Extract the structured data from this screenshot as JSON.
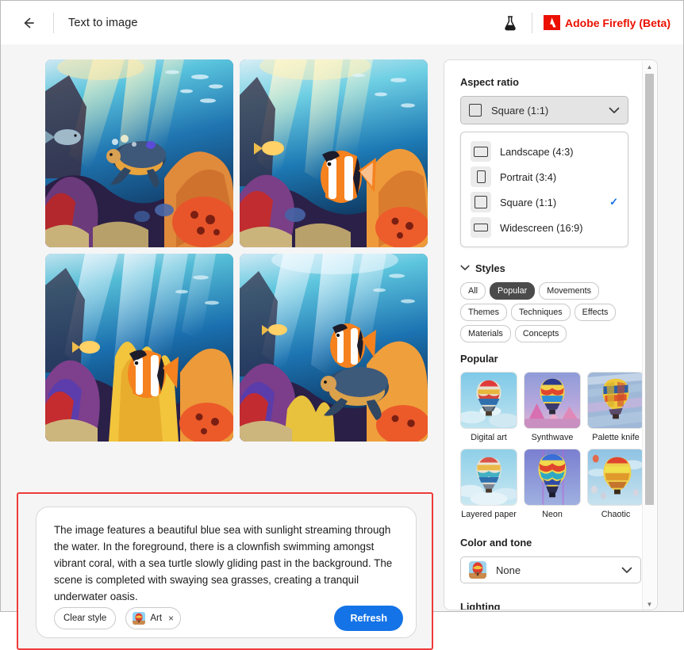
{
  "topbar": {
    "back_icon": "arrow-left-icon",
    "title": "Text to image",
    "beaker_icon": "flask-icon",
    "brand": "Adobe Firefly (Beta)",
    "brand_color": "#eb1000"
  },
  "gallery": {
    "count": 4,
    "items": [
      {
        "alt": "underwater scene with sea turtle and coral"
      },
      {
        "alt": "underwater scene with clownfish and coral"
      },
      {
        "alt": "underwater scene with clownfish and yellow coral"
      },
      {
        "alt": "underwater scene with clownfish and sea turtle"
      }
    ]
  },
  "prompt": {
    "text": "The image features a beautiful blue sea with sunlight streaming through the water. In the foreground, there is a clownfish swimming amongst vibrant coral, with a sea turtle slowly gliding past in the background. The scene is completed with swaying sea grasses, creating a tranquil underwater oasis.",
    "clear_style_label": "Clear style",
    "style_chip": {
      "label": "Art",
      "remove_icon": "close-icon"
    },
    "refresh_label": "Refresh",
    "refresh_color": "#1473e6"
  },
  "sidebar": {
    "aspect_ratio": {
      "heading": "Aspect ratio",
      "selected": "Square (1:1)",
      "chevron_icon": "chevron-down-icon",
      "options": [
        {
          "label": "Landscape (4:3)",
          "icon": "rect-landscape-icon",
          "checked": false
        },
        {
          "label": "Portrait (3:4)",
          "icon": "rect-portrait-icon",
          "checked": false
        },
        {
          "label": "Square (1:1)",
          "icon": "rect-square-icon",
          "checked": true
        },
        {
          "label": "Widescreen (16:9)",
          "icon": "rect-widescreen-icon",
          "checked": true
        }
      ]
    },
    "styles": {
      "heading": "Styles",
      "collapse_icon": "chevron-down-icon",
      "filters": [
        {
          "label": "All",
          "active": false
        },
        {
          "label": "Popular",
          "active": true
        },
        {
          "label": "Movements",
          "active": false
        },
        {
          "label": "Themes",
          "active": false
        },
        {
          "label": "Techniques",
          "active": false
        },
        {
          "label": "Effects",
          "active": false
        },
        {
          "label": "Materials",
          "active": false
        },
        {
          "label": "Concepts",
          "active": false
        }
      ],
      "group_heading": "Popular",
      "items": [
        {
          "label": "Digital art"
        },
        {
          "label": "Synthwave"
        },
        {
          "label": "Palette knife"
        },
        {
          "label": "Layered paper"
        },
        {
          "label": "Neon"
        },
        {
          "label": "Chaotic"
        }
      ]
    },
    "color_and_tone": {
      "heading": "Color and tone",
      "selected": "None",
      "chevron_icon": "chevron-down-icon"
    },
    "lighting": {
      "heading": "Lighting"
    },
    "scrollbar": {
      "up_icon": "caret-up-icon",
      "down_icon": "caret-down-icon"
    }
  },
  "highlight": {
    "color": "#ef3b3b"
  }
}
